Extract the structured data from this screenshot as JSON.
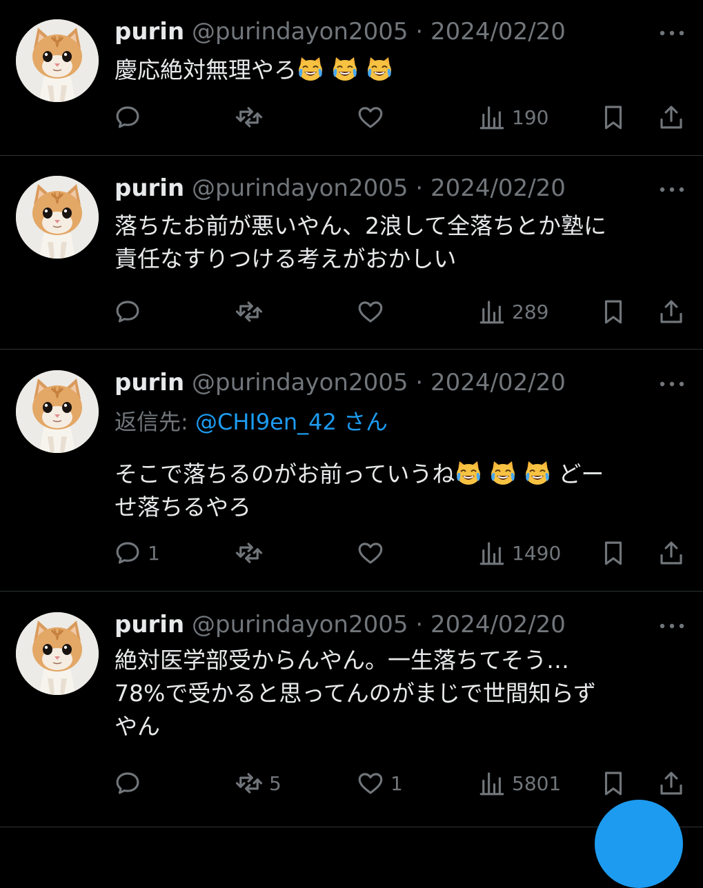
{
  "tweets": [
    {
      "name": "purin",
      "handle": "@purindayon2005",
      "sep": "·",
      "date": "2024/02/20",
      "reply_prefix": "",
      "reply_to": "",
      "reply_suffix": "",
      "lines": [
        {
          "text": "慶応絶対無理やろ",
          "emoji_count": 3,
          "after": ""
        }
      ],
      "stats": {
        "replies": "",
        "reposts": "",
        "likes": "",
        "views": "190"
      }
    },
    {
      "name": "purin",
      "handle": "@purindayon2005",
      "sep": "·",
      "date": "2024/02/20",
      "reply_prefix": "",
      "reply_to": "",
      "reply_suffix": "",
      "lines": [
        {
          "text": "落ちたお前が悪いやん、2浪して全落ちとか塾に",
          "emoji_count": 0,
          "after": ""
        },
        {
          "text": "責任なすりつける考えがおかしい",
          "emoji_count": 0,
          "after": ""
        }
      ],
      "stats": {
        "replies": "",
        "reposts": "",
        "likes": "",
        "views": "289"
      }
    },
    {
      "name": "purin",
      "handle": "@purindayon2005",
      "sep": "·",
      "date": "2024/02/20",
      "reply_prefix": "返信先: ",
      "reply_to": "@CHI9en_42",
      "reply_suffix": "さん",
      "lines": [
        {
          "text": "そこで落ちるのがお前っていうね",
          "emoji_count": 3,
          "after": "どー"
        },
        {
          "text": "せ落ちるやろ",
          "emoji_count": 0,
          "after": ""
        }
      ],
      "stats": {
        "replies": "1",
        "reposts": "",
        "likes": "",
        "views": "1490"
      }
    },
    {
      "name": "purin",
      "handle": "@purindayon2005",
      "sep": "·",
      "date": "2024/02/20",
      "reply_prefix": "",
      "reply_to": "",
      "reply_suffix": "",
      "lines": [
        {
          "text": "絶対医学部受からんやん。一生落ちてそう…",
          "emoji_count": 0,
          "after": ""
        },
        {
          "text": "78%で受かると思ってんのがまじで世間知らず",
          "emoji_count": 0,
          "after": ""
        },
        {
          "text": "やん",
          "emoji_count": 0,
          "after": ""
        }
      ],
      "stats": {
        "replies": "",
        "reposts": "5",
        "likes": "1",
        "views": "5801"
      }
    }
  ],
  "emoji": "cat-with-tears-of-joy",
  "icons": {
    "reply": "speech-bubble-icon",
    "repost": "repost-arrows-icon",
    "like": "heart-icon",
    "views": "bar-chart-icon",
    "bookmark": "bookmark-icon",
    "share": "share-upload-icon",
    "more": "more-dots-icon"
  },
  "colors": {
    "background": "#000000",
    "text": "#e7e9ea",
    "muted": "#71767b",
    "accent": "#1d9bf0",
    "divider": "#2f3336"
  }
}
